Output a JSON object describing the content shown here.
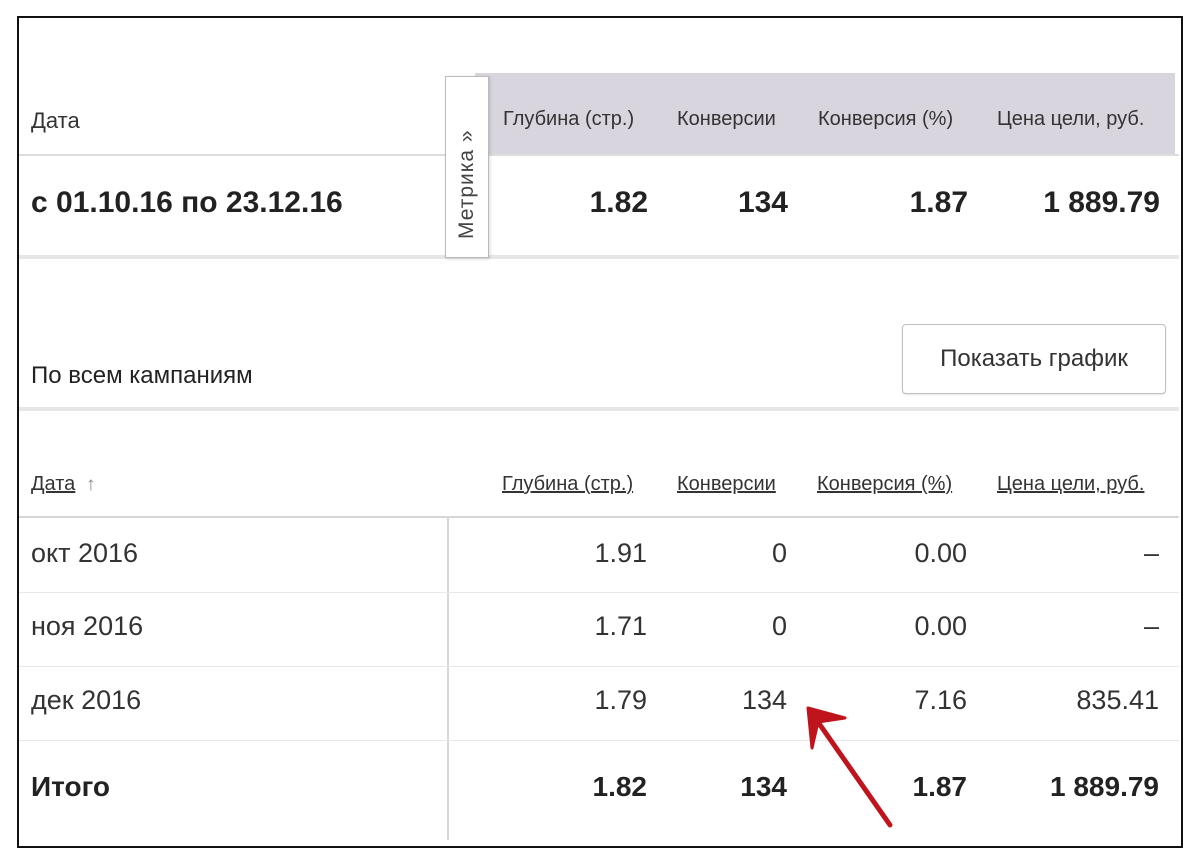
{
  "top": {
    "date_label": "Дата",
    "headers": {
      "depth": "Глубина (стр.)",
      "conversions": "Конверсии",
      "conversion_pct": "Конверсия (%)",
      "goal_price": "Цена цели, руб."
    },
    "metrika_tab": "Метрика »",
    "period": "с 01.10.16 по 23.12.16",
    "values": {
      "depth": "1.82",
      "conversions": "134",
      "conversion_pct": "1.87",
      "goal_price": "1 889.79"
    }
  },
  "section": {
    "title": "По всем кампаниям",
    "show_chart_button": "Показать график"
  },
  "table": {
    "headers": {
      "date": "Дата",
      "sort_indicator": "↑",
      "depth": "Глубина (стр.)",
      "conversions": "Конверсии",
      "conversion_pct": "Конверсия (%)",
      "goal_price": "Цена цели, руб."
    },
    "rows": [
      {
        "date": "окт 2016",
        "depth": "1.91",
        "conversions": "0",
        "conversion_pct": "0.00",
        "goal_price": "–"
      },
      {
        "date": "ноя 2016",
        "depth": "1.71",
        "conversions": "0",
        "conversion_pct": "0.00",
        "goal_price": "–"
      },
      {
        "date": "дек 2016",
        "depth": "1.79",
        "conversions": "134",
        "conversion_pct": "7.16",
        "goal_price": "835.41"
      }
    ],
    "total": {
      "date": "Итого",
      "depth": "1.82",
      "conversions": "134",
      "conversion_pct": "1.87",
      "goal_price": "1 889.79"
    }
  },
  "colors": {
    "header_band": "#d9d5df",
    "annotation_arrow": "#c0141c"
  },
  "icons": {
    "sort": "arrow-up-icon",
    "annotation": "red-arrow-annotation"
  }
}
